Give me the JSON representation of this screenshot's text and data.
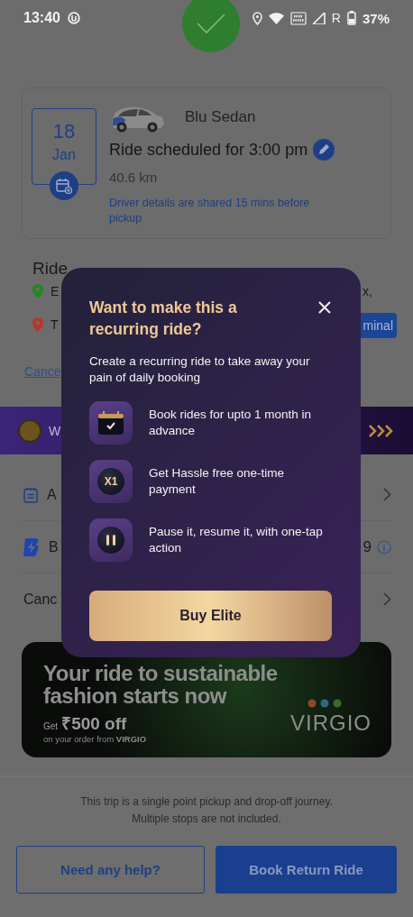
{
  "status_bar": {
    "time": "13:40",
    "network_type": "R",
    "battery": "37%"
  },
  "ride_card": {
    "day": "18",
    "month": "Jan",
    "car_name": "Blu Sedan",
    "schedule": "Ride scheduled for 3:00 pm",
    "distance": "40.6 km",
    "driver_note": "Driver details are shared 15 mins before pickup"
  },
  "ride_details": {
    "heading": "Ride",
    "stops": [
      {
        "kind": "pickup",
        "label": "E",
        "trailing": "x,"
      },
      {
        "kind": "drop",
        "label": "T",
        "trailing": "minal"
      }
    ],
    "cancel_link": "Cance"
  },
  "promo_strip": {
    "label": "W"
  },
  "rows": [
    {
      "kind": "notes",
      "label": "A"
    },
    {
      "kind": "brand",
      "label": "B",
      "value": "9"
    },
    {
      "kind": "plain",
      "label": "Canc"
    }
  ],
  "ad": {
    "headline": "Your ride to sustainable fashion starts now",
    "offer_prefix": "Get",
    "offer": "₹500 off",
    "offer_note": "on your order from **VIRGIO**",
    "brand": "VIRGIO"
  },
  "footer": {
    "note_lines": [
      "This trip is a single point pickup and drop-off journey.",
      "Multiple stops are not included."
    ],
    "buttons": [
      {
        "kind": "outline",
        "label": "Need any help?"
      },
      {
        "kind": "filled",
        "label": "Book Return Ride"
      }
    ]
  },
  "modal": {
    "title": "Want to make this a recurring ride?",
    "description": "Create a recurring ride to take away your pain of daily booking",
    "features": [
      {
        "kind": "calendar",
        "text": "Book rides for upto 1 month in advance"
      },
      {
        "kind": "badge",
        "badge": "X1",
        "text": "Get Hassle free one-time payment"
      },
      {
        "kind": "pause",
        "text": "Pause it, resume it, with one-tap action"
      }
    ],
    "cta": "Buy Elite"
  }
}
